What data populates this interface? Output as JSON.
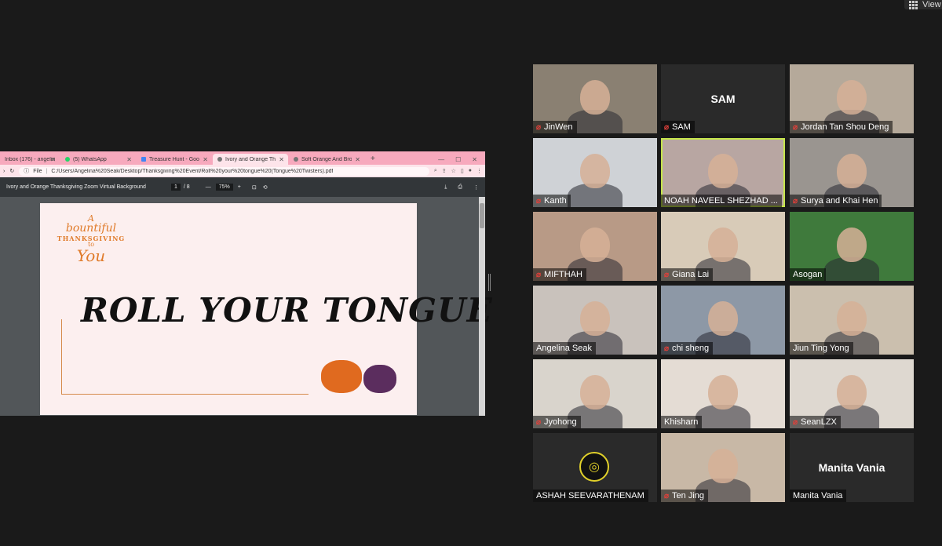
{
  "app": {
    "view_label": "View"
  },
  "browser": {
    "tabs": [
      {
        "label": "Inbox (176) - angelinaseak",
        "icon": "mail-icon",
        "active": false
      },
      {
        "label": "(5) WhatsApp",
        "icon": "whatsapp-icon",
        "active": false
      },
      {
        "label": "Treasure Hunt - Google D",
        "icon": "docs-icon",
        "active": false
      },
      {
        "label": "Ivory and Orange Thanksg",
        "icon": "globe-icon",
        "active": true
      },
      {
        "label": "Soft Orange And Brown",
        "icon": "globe-icon",
        "active": false
      }
    ],
    "new_tab": "+",
    "address_scheme": "File",
    "address_path": "C:/Users/Angelina%20Seak/Desktop/Thanksgiving%20Event/Roll%20your%20tongue%20(Tongue%20Twisters).pdf"
  },
  "pdf": {
    "title": "Ivory and Orange Thanksgiving Zoom Virtual Background",
    "page_current": "1",
    "page_total": "/ 8",
    "zoom": "75%",
    "zoom_minus": "—",
    "zoom_plus": "+"
  },
  "slide": {
    "brand_a": "A",
    "brand_b": "bountiful",
    "brand_c": "THANKSGIVING",
    "brand_d": "to",
    "brand_e": "You",
    "title": "ROLL YOUR TONGUE"
  },
  "participants": [
    {
      "name": "JinWen",
      "muted": true,
      "video": true,
      "bg": "#8a8072"
    },
    {
      "name": "SAM",
      "muted": true,
      "video": false,
      "display": "SAM"
    },
    {
      "name": "Jordan Tan Shou Deng",
      "muted": true,
      "video": true,
      "bg": "#b5a99a"
    },
    {
      "name": "Kanth",
      "muted": true,
      "video": true,
      "bg": "#cfd2d6"
    },
    {
      "name": "NOAH NAVEEL SHEZHAD ...",
      "muted": false,
      "video": true,
      "bg": "#b8a6a2",
      "active": true
    },
    {
      "name": "Surya and Khai Hen",
      "muted": true,
      "video": true,
      "bg": "#9a9590"
    },
    {
      "name": "MIFTHAH",
      "muted": true,
      "video": true,
      "bg": "#b89a86"
    },
    {
      "name": "Giana Lai",
      "muted": true,
      "video": true,
      "bg": "#d8cbb8"
    },
    {
      "name": "Asogan",
      "muted": false,
      "video": true,
      "bg": "#3f7a3c"
    },
    {
      "name": "Angelina Seak",
      "muted": false,
      "video": true,
      "bg": "#c9c2bc"
    },
    {
      "name": "chi sheng",
      "muted": true,
      "video": true,
      "bg": "#8d98a6"
    },
    {
      "name": "Jiun Ting Yong",
      "muted": false,
      "video": true,
      "bg": "#cbbfae"
    },
    {
      "name": "Jyohong",
      "muted": true,
      "video": true,
      "bg": "#d9d4cc"
    },
    {
      "name": "Khisharn",
      "muted": false,
      "video": true,
      "bg": "#e4dcd4"
    },
    {
      "name": "SeanLZX",
      "muted": true,
      "video": true,
      "bg": "#ded8d0"
    },
    {
      "name": "ASHAH SEEVARATHENAM",
      "muted": false,
      "video": false,
      "logo": true
    },
    {
      "name": "Ten Jing",
      "muted": true,
      "video": true,
      "bg": "#c8b8a6"
    },
    {
      "name": "Manita Vania",
      "muted": false,
      "video": false,
      "display": "Manita Vania"
    }
  ],
  "colors": {
    "active_speaker": "#c6e64b",
    "muted": "#e0403a",
    "slide_accent": "#e07b2a"
  }
}
